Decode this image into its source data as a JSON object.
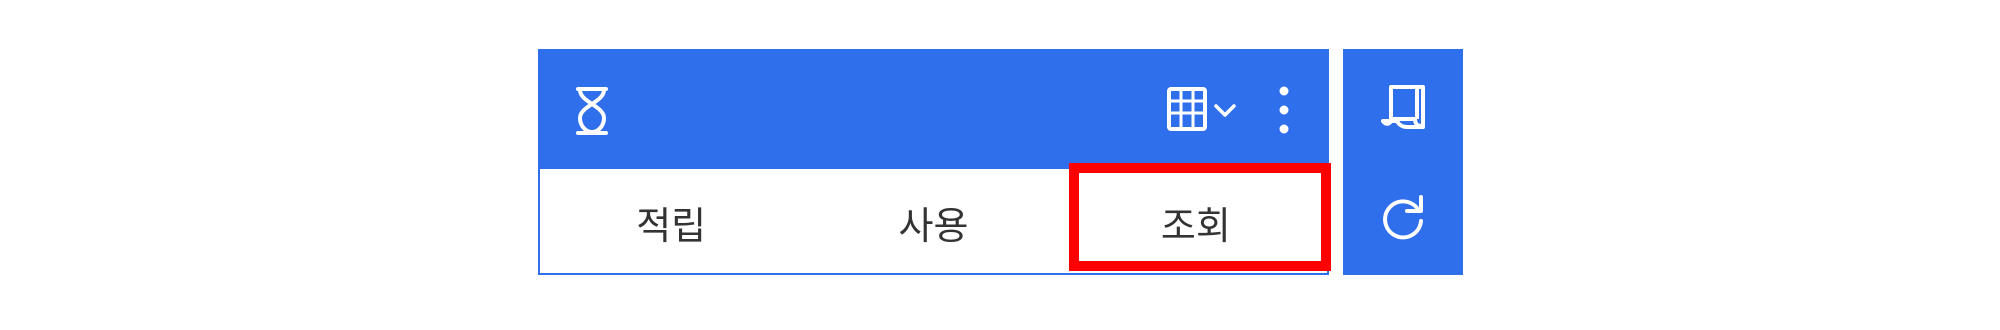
{
  "header": {
    "logo_icon": "hourglass-icon",
    "view_icon": "grid-view-icon",
    "view_dropdown_icon": "chevron-down-icon",
    "menu_icon": "more-vertical-icon"
  },
  "tabs": [
    {
      "label": "적립"
    },
    {
      "label": "사용"
    },
    {
      "label": "조회"
    }
  ],
  "side": {
    "buttons": [
      {
        "icon": "receipt-scroll-icon"
      },
      {
        "icon": "refresh-icon"
      }
    ]
  },
  "colors": {
    "primary": "#2f6fec",
    "highlight": "#ff0000",
    "tab_text": "#333333"
  }
}
